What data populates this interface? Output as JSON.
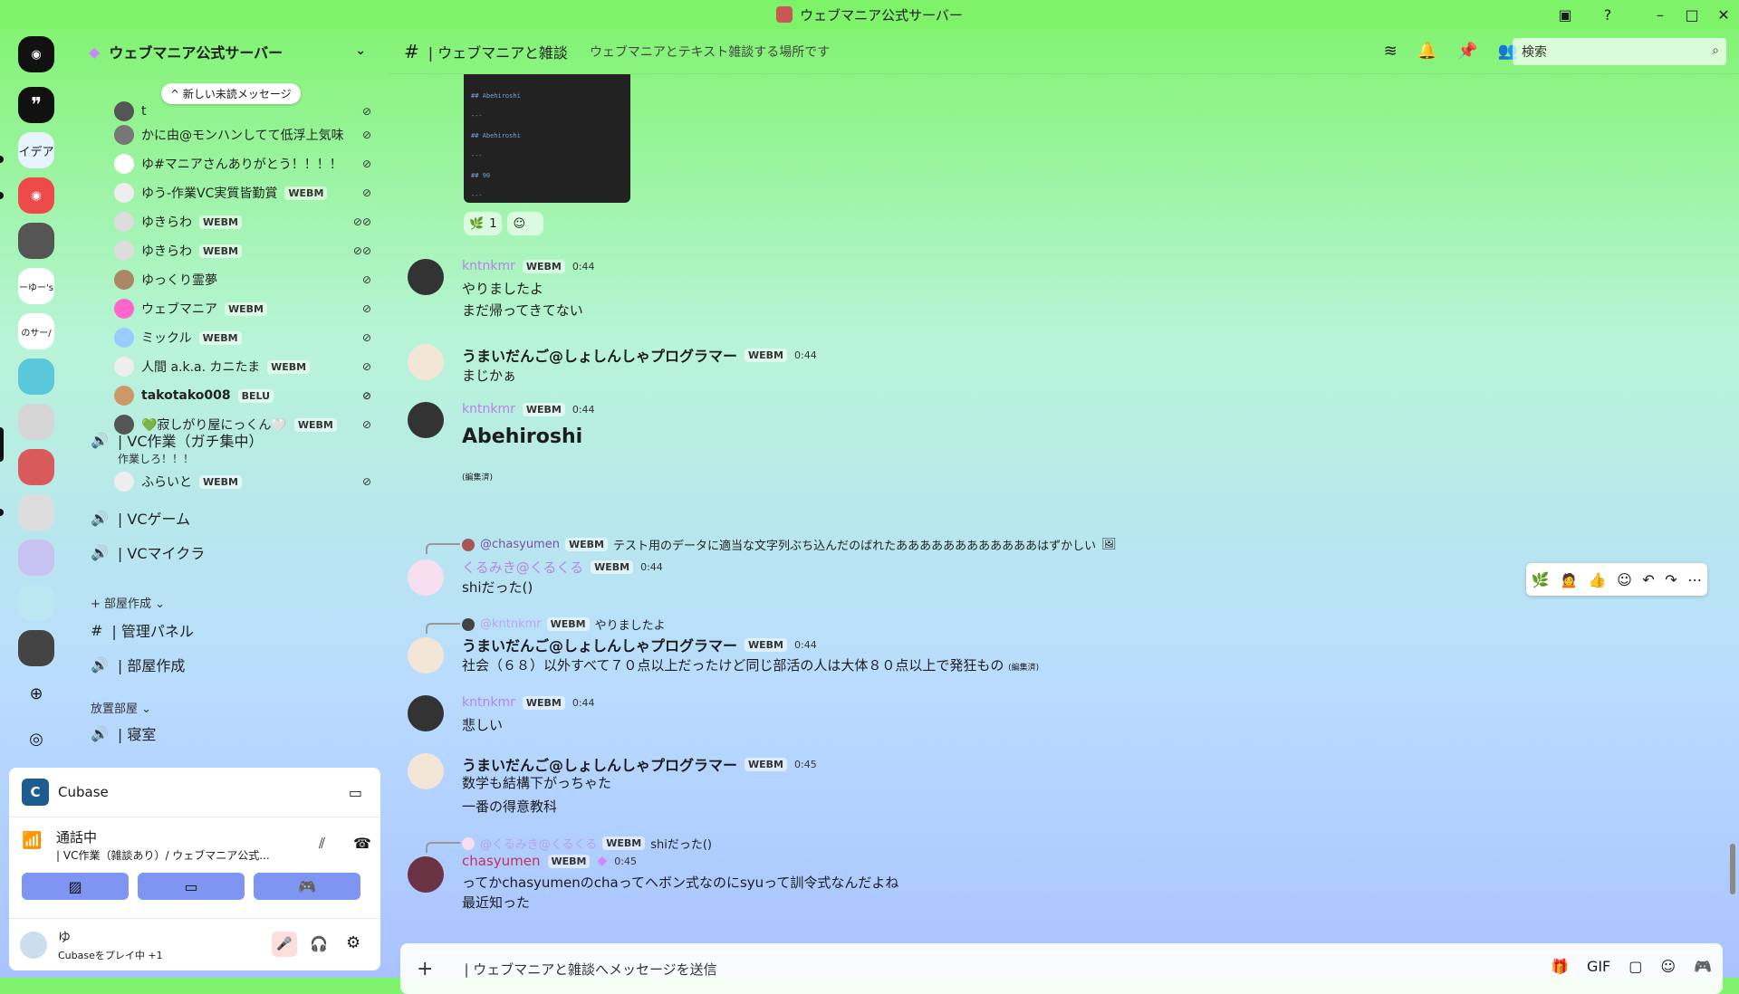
{
  "window": {
    "title": "ウェブマニア公式サーバー"
  },
  "rail": {
    "labels": [
      "イデア",
      "ーゆー's",
      "のサー/"
    ]
  },
  "server": {
    "name": "ウェブマニア公式サーバー",
    "new_unread": "新しい未読メッセージ"
  },
  "members": [
    {
      "name": "t",
      "tag": ""
    },
    {
      "name": "かに由@モンハンしてて低浮上気味",
      "tag": ""
    },
    {
      "name": "ゆ#マニアさんありがとう！！！！",
      "tag": ""
    },
    {
      "name": "ゆう-作業VC実質皆勤賞",
      "tag": "WEBM"
    },
    {
      "name": "ゆきらわ",
      "tag": "WEBM"
    },
    {
      "name": "ゆきらわ",
      "tag": "WEBM"
    },
    {
      "name": "ゆっくり霊夢",
      "tag": ""
    },
    {
      "name": "ウェブマニア",
      "tag": "WEBM"
    },
    {
      "name": "ミックル",
      "tag": "WEBM"
    },
    {
      "name": "人間 a.k.a. カニたま",
      "tag": "WEBM"
    },
    {
      "name": "takotako008",
      "tag": "BELU"
    },
    {
      "name": "💚寂しがり屋にっくん🤍",
      "tag": "WEBM"
    }
  ],
  "vc_work": {
    "name": "| VC作業（ガチ集中）",
    "status": "作業しろ！！！",
    "member": "ふらいと",
    "member_tag": "WEBM"
  },
  "vc_game": "| VCゲーム",
  "vc_micra": "| VCマイクラ",
  "cat_room": "部屋作成",
  "ch_admin": "| 管理パネル",
  "ch_room": "| 部屋作成",
  "cat_idle": "放置部屋",
  "ch_sleep": "| 寝室",
  "activity": {
    "game": "Cubase",
    "voice_status": "通話中",
    "voice_channel": "| VC作業（雑談あり）/ ウェブマニア公式...",
    "username": "ゆ",
    "user_status": "Cubaseをプレイ中 +1"
  },
  "channel": {
    "name": "| ウェブマニアと雑談",
    "topic": "ウェブマニアとテキスト雑談する場所です",
    "search_placeholder": "検索"
  },
  "code": [
    "## Abehiroshi",
    "---",
    "## Abehiroshi",
    "---",
    "## 90",
    "---"
  ],
  "reaction_count": "1",
  "messages": [
    {
      "user": "kntnkmr",
      "tag": "WEBM",
      "time": "0:44",
      "lines": [
        "やりましたよ",
        "まだ帰ってきてない"
      ]
    },
    {
      "user": "うまいだんご@しょしんしゃプログラマー",
      "tag": "WEBM",
      "time": "0:44",
      "lines": [
        "まじかぁ"
      ]
    },
    {
      "user": "kntnkmr",
      "tag": "WEBM",
      "time": "0:44",
      "heading": "Abehiroshi",
      "edited": "(編集済)"
    },
    {
      "reply_user": "@chasyumen",
      "reply_tag": "WEBM",
      "reply_text": "テスト用のデータに適当な文字列ぶち込んだのばれたああああああああああああはずかしい",
      "user": "くるみき@くるくる",
      "tag": "WEBM",
      "time": "0:44",
      "lines": [
        "shiだった()"
      ]
    },
    {
      "reply_user": "@kntnkmr",
      "reply_tag": "WEBM",
      "reply_text": "やりましたよ",
      "user": "うまいだんご@しょしんしゃプログラマー",
      "tag": "WEBM",
      "time": "0:44",
      "lines": [
        "社会（６８）以外すべて７０点以上だったけど同じ部活の人は大体８０点以上で発狂もの"
      ],
      "edited": "(編集済)"
    },
    {
      "user": "kntnkmr",
      "tag": "WEBM",
      "time": "0:44",
      "lines": [
        "悲しい"
      ]
    },
    {
      "user": "うまいだんご@しょしんしゃプログラマー",
      "tag": "WEBM",
      "time": "0:45",
      "lines": [
        "数学も結構下がっちゃた",
        "一番の得意教科"
      ]
    },
    {
      "reply_user": "@くるみき@くるくる",
      "reply_tag": "WEBM",
      "reply_text": "shiだった()",
      "user": "chasyumen",
      "tag": "WEBM",
      "time": "0:45",
      "lines": [
        "ってかchasyumenのchaってヘボン式なのにsyuって訓令式なんだよね",
        "最近知った"
      ]
    }
  ],
  "composer": {
    "placeholder": "| ウェブマニアと雑談へメッセージを送信"
  },
  "colors": {
    "accent": "#7ef36a",
    "brand": "#5865f2",
    "link": "#b684e8"
  }
}
